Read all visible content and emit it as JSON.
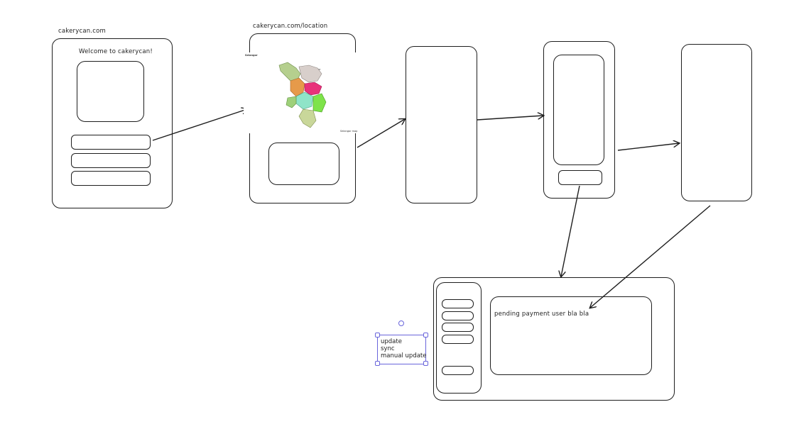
{
  "colors": {
    "stroke": "#1e1e1e",
    "selection": "#6965db",
    "background": "#ffffff"
  },
  "frame1": {
    "url": "cakerycan.com",
    "welcome": "Welcome to cakerycan!"
  },
  "frame2": {
    "url": "cakerycan.com/location",
    "map_corner_label": "Selangor",
    "map_region_label": "Hulu Selangor",
    "map_footer": "Selangor map"
  },
  "dashboard": {
    "content_text": "pending payment user bla bla"
  },
  "note": {
    "lines": [
      "update",
      "sync",
      "manual update"
    ]
  }
}
